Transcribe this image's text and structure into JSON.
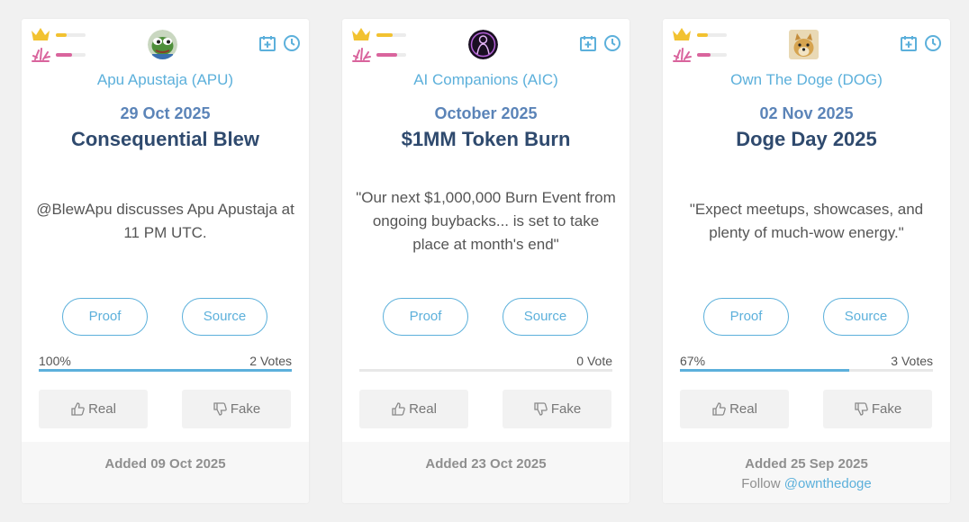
{
  "colors": {
    "accent": "#5cb0db",
    "crown": "#f2c230",
    "spark": "#d9649d",
    "title": "#2f4a6e",
    "date": "#5b84b8"
  },
  "cards": [
    {
      "crown_level": 0.35,
      "spark_level": 0.55,
      "avatar_icon": "pepe-frog-avatar",
      "token": "Apu Apustaja (APU)",
      "date": "29 Oct 2025",
      "title": "Consequential Blew",
      "description": "@BlewApu discusses Apu Apustaja at 11 PM UTC.",
      "proof_label": "Proof",
      "source_label": "Source",
      "percent": "100%",
      "votes": "2 Votes",
      "real_share": 1.0,
      "real_label": "Real",
      "fake_label": "Fake",
      "added": "Added 09 Oct 2025"
    },
    {
      "crown_level": 0.55,
      "spark_level": 0.7,
      "avatar_icon": "ai-companion-avatar",
      "token": "AI Companions (AIC)",
      "date": "October 2025",
      "title": "$1MM Token Burn",
      "description": "\"Our next $1,000,000 Burn Event from ongoing buybacks... is set to take place at month's end\"",
      "proof_label": "Proof",
      "source_label": "Source",
      "percent": "",
      "votes": "0 Vote",
      "real_share": 0,
      "real_label": "Real",
      "fake_label": "Fake",
      "added": "Added 23 Oct 2025"
    },
    {
      "crown_level": 0.35,
      "spark_level": 0.45,
      "avatar_icon": "doge-avatar",
      "token": "Own The Doge (DOG)",
      "date": "02 Nov 2025",
      "title": "Doge Day 2025",
      "description": "\"Expect meetups, showcases, and plenty of much-wow energy.\"",
      "proof_label": "Proof",
      "source_label": "Source",
      "percent": "67%",
      "votes": "3 Votes",
      "real_share": 0.67,
      "real_label": "Real",
      "fake_label": "Fake",
      "added": "Added 25 Sep 2025",
      "follow_prefix": "Follow ",
      "follow_handle": "@ownthedoge"
    }
  ]
}
